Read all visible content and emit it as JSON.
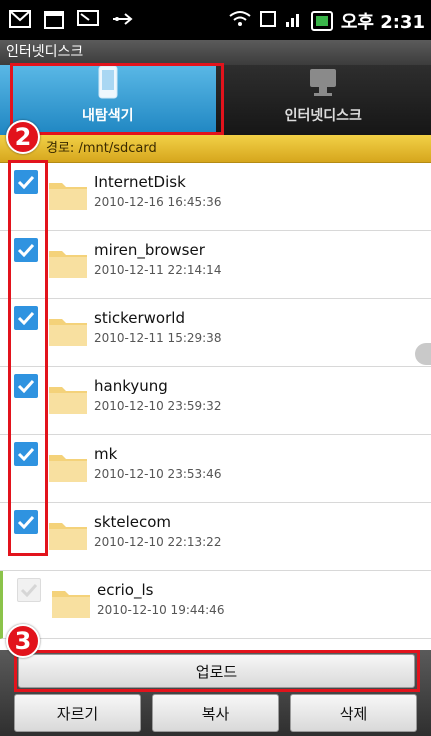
{
  "status_bar": {
    "time": "오후 2:31",
    "icons": [
      "mail-icon",
      "calendar-icon",
      "sms-icon",
      "usb-icon"
    ],
    "right_icons": [
      "wifi-icon",
      "sync-icon",
      "signal-icon",
      "battery-icon"
    ]
  },
  "app_title": "인터넷디스크",
  "tabs": [
    {
      "label": "내탐색기",
      "icon": "phone-icon",
      "active": true
    },
    {
      "label": "인터넷디스크",
      "icon": "computer-icon",
      "active": false
    }
  ],
  "path": {
    "label": "경로:",
    "value": "/mnt/sdcard"
  },
  "files": [
    {
      "name": "InternetDisk",
      "date": "2010-12-16 16:45:36",
      "checked": true
    },
    {
      "name": "miren_browser",
      "date": "2010-12-11 22:14:14",
      "checked": true
    },
    {
      "name": "stickerworld",
      "date": "2010-12-11 15:29:38",
      "checked": true
    },
    {
      "name": "hankyung",
      "date": "2010-12-10 23:59:32",
      "checked": true
    },
    {
      "name": "mk",
      "date": "2010-12-10 23:53:46",
      "checked": true
    },
    {
      "name": "sktelecom",
      "date": "2010-12-10 22:13:22",
      "checked": true
    },
    {
      "name": "ecrio_ls",
      "date": "2010-12-10 19:44:46",
      "checked": false
    }
  ],
  "buttons": {
    "upload": "업로드",
    "cut": "자르기",
    "copy": "복사",
    "delete": "삭제"
  },
  "badges": [
    "2",
    "3"
  ],
  "colors": {
    "tab_active": "#1f86c2",
    "path_bar": "#e8c436",
    "checkbox": "#2f93e0",
    "callout": "#e2131c"
  }
}
